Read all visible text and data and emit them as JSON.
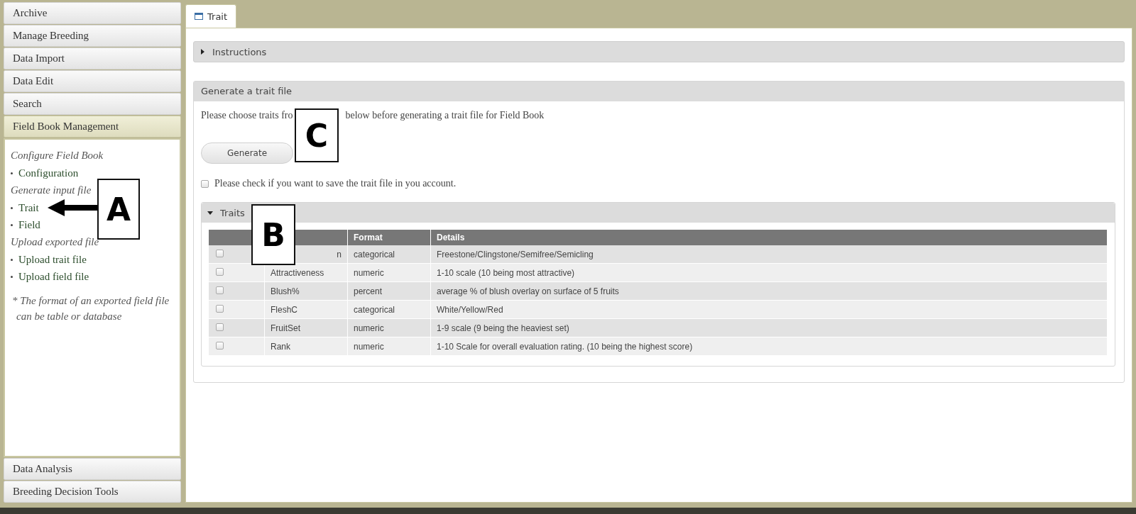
{
  "sidebar": {
    "items": [
      {
        "label": "Archive",
        "expanded": false
      },
      {
        "label": "Manage Breeding",
        "expanded": false
      },
      {
        "label": "Data Import",
        "expanded": false
      },
      {
        "label": "Data Edit",
        "expanded": false
      },
      {
        "label": "Search",
        "expanded": false
      },
      {
        "label": "Field Book Management",
        "expanded": true,
        "sections": [
          {
            "heading": "Configure Field Book",
            "links": [
              "Configuration"
            ]
          },
          {
            "heading": "Generate input file",
            "links": [
              "Trait",
              "Field"
            ]
          },
          {
            "heading": "Upload exported file",
            "links": [
              "Upload trait file",
              "Upload field file"
            ]
          }
        ],
        "note": "* The format of an exported field file can be table or database"
      },
      {
        "label": "Data Analysis",
        "expanded": false
      },
      {
        "label": "Breeding Decision Tools",
        "expanded": false
      }
    ]
  },
  "tabs": [
    {
      "label": "Trait",
      "selected": true
    }
  ],
  "instructions": {
    "label": "Instructions",
    "expanded": false
  },
  "generate_panel": {
    "title": "Generate a trait file",
    "instruction_parts": [
      "Please choose traits fro",
      "below before generating a trait file for Field Book"
    ],
    "button": "Generate",
    "save_checkbox": {
      "label": "Please check if you want to save the trait file in you account.",
      "checked": false
    }
  },
  "traits": {
    "label": "Traits",
    "expanded": true,
    "columns": [
      "Format",
      "Details"
    ],
    "rows": [
      {
        "name": "n",
        "format": "categorical",
        "details": "Freestone/Clingstone/Semifree/Semicling",
        "checked": false
      },
      {
        "name": "Attractiveness",
        "format": "numeric",
        "details": "1-10 scale (10 being most attractive)",
        "checked": false
      },
      {
        "name": "Blush%",
        "format": "percent",
        "details": "average % of blush overlay on surface of 5 fruits",
        "checked": false
      },
      {
        "name": "FleshC",
        "format": "categorical",
        "details": "White/Yellow/Red",
        "checked": false
      },
      {
        "name": "FruitSet",
        "format": "numeric",
        "details": "1-9 scale (9 being the heaviest set)",
        "checked": false
      },
      {
        "name": "Rank",
        "format": "numeric",
        "details": "1-10 Scale for overall evaluation rating. (10 being the highest score)",
        "checked": false
      }
    ]
  },
  "callouts": [
    "A",
    "B",
    "C"
  ]
}
